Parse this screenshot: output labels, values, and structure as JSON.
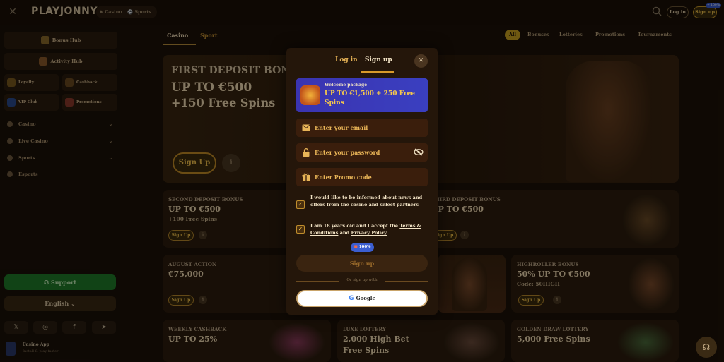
{
  "header": {
    "logo": "PLAYJONNY",
    "casino_label": "Casino",
    "sports_label": "Sports",
    "login_label": "Log in",
    "signup_label": "Sign up",
    "signup_badge": "+ 100%"
  },
  "sidebar": {
    "bonus_hub": "Bonus Hub",
    "activity_hub": "Activity Hub",
    "tiles": [
      "Loyalty",
      "Cashback",
      "VIP Club",
      "Promotions"
    ],
    "nav": [
      "Casino",
      "Live Casino",
      "Sports",
      "Esports"
    ],
    "support": "Support",
    "language": "English",
    "app_title": "Casino App",
    "app_sub": "Install & play faster"
  },
  "main": {
    "tabs": [
      "Casino",
      "Sport"
    ],
    "chips": [
      "All",
      "Bonuses",
      "Lotteries",
      "Promotions",
      "Tournaments"
    ],
    "hero": {
      "title": "FIRST DEPOSIT BONUS",
      "line1": "UP TO €500",
      "line2": "+150 Free Spins",
      "cta": "Sign Up"
    },
    "cards": [
      {
        "title": "SECOND DEPOSIT BONUS",
        "value": "UP TO €500",
        "sub": "+100 Free Spins",
        "cta": "Sign Up"
      },
      {
        "title": "THIRD DEPOSIT BONUS",
        "value": "UP TO €500",
        "sub": "",
        "cta": "Sign Up"
      },
      {
        "title": "AUGUST ACTION",
        "value": "€75,000",
        "sub": "",
        "cta": "Sign Up"
      },
      {
        "title": "HIGHROLLER BONUS",
        "value": "50% UP TO €500",
        "sub": "Code: 50HIGH",
        "cta": "Sign Up"
      },
      {
        "title": "WEEKLY CASHBACK",
        "value": "UP TO 25%",
        "sub": ""
      },
      {
        "title": "LUXE LOTTERY",
        "value": "2,000 High Bet",
        "sub": "Free Spins"
      },
      {
        "title": "GOLDEN DRAW LOTTERY",
        "value": "5,000 Free Spins",
        "sub": ""
      }
    ]
  },
  "modal": {
    "tab_login": "Log in",
    "tab_signup": "Sign up",
    "package_label": "Welcome package",
    "package_value": "UP TO €1,500 + 250 Free Spins",
    "email_placeholder": "Enter your email",
    "password_placeholder": "Enter your password",
    "promo_placeholder": "Enter Promo code",
    "consent_news": "I would like to be informed about news and offers from the casino and select partners",
    "consent_terms_pre": "I am 18 years old and I accept the ",
    "terms_link": "Terms & Conditions",
    "consent_and": " and ",
    "privacy_link": "Privacy Policy",
    "bonus_pill": "100%",
    "submit": "Sign up",
    "divider": "Or sign up with",
    "google": "Google"
  },
  "colors": {
    "accent": "#f0c04a",
    "support_green": "#1f7a28",
    "package_blue": "#3b3fb8"
  }
}
